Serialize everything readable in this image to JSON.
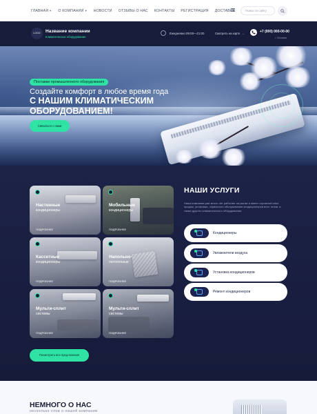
{
  "nav": {
    "items": [
      "ГЛАВНАЯ",
      "О КОМПАНИИ",
      "НОВОСТИ",
      "ОТЗЫВЫ О НАС",
      "КОНТАКТЫ",
      "РЕГИСТРАЦИЯ",
      "ДОСТАВКА"
    ],
    "search_placeholder": "Поиск по сайту"
  },
  "header": {
    "logo": "LOGO",
    "company_name": "Название компании",
    "tagline": "Климатическое оборудование",
    "hours": "Ежедневно 09:00—21:00",
    "map_link": "Смотреть на карте",
    "map_arrow": "→",
    "phone": "+7 (000) 000-00-00",
    "city": "г. Москва"
  },
  "hero": {
    "badge": "Поставки промышленного оборудования",
    "line1": "Создайте комфорт в любое время года",
    "line2": "С НАШИМ КЛИМАТИЧЕСКИМ",
    "line3": "ОБОРУДОВАНИЕМ!",
    "cta": "Связаться с нами"
  },
  "services": {
    "title": "НАШИ УСЛУГИ",
    "description": "Наша компания уже много лет работает на рынке и имеет огромный опыт продаж, установки, сервисного обслуживания кондиционеров всех типов, а также другого климатического оборудования.",
    "cards": [
      {
        "title": "Настенные",
        "subtitle": "кондиционеры",
        "more": "ПОДРОБНЕЕ"
      },
      {
        "title": "Мобильные",
        "subtitle": "кондиционеры",
        "more": "ПОДРОБНЕЕ"
      },
      {
        "title": "Кассетные",
        "subtitle": "кондиционеры",
        "more": "ПОДРОБНЕЕ"
      },
      {
        "title": "Напольно-",
        "subtitle": "потолочные",
        "more": "ПОДРОБНЕЕ"
      },
      {
        "title": "Мульти-сплит",
        "subtitle": "системы",
        "more": "ПОДРОБНЕЕ"
      },
      {
        "title": "Мульти-сплит",
        "subtitle": "системы",
        "more": "ПОДРОБНЕЕ"
      }
    ],
    "list": [
      "Кондиционеры",
      "Увлажнители воздуха",
      "Установка кондиционеров",
      "Ремонт кондиционеров"
    ],
    "all_button": "Посмотреть все предложения"
  },
  "about": {
    "title": "НЕМНОГО О НАС",
    "subtitle": "несколько слов о нашей компании"
  },
  "colors": {
    "accent": "#2ee3a4",
    "dark": "#171c3a",
    "navy": "#1d2347"
  }
}
